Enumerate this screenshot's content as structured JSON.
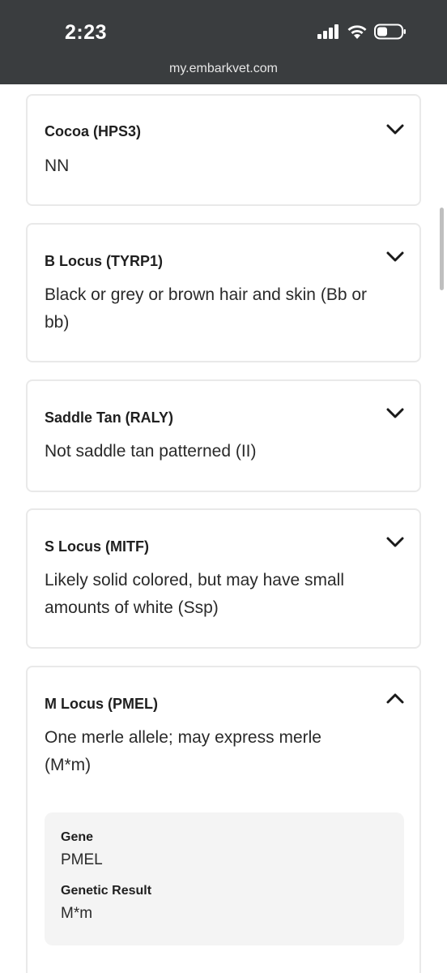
{
  "status_bar": {
    "time": "2:23",
    "url": "my.embarkvet.com",
    "icons": [
      "signal-icon",
      "wifi-icon",
      "battery-icon"
    ]
  },
  "traits": [
    {
      "title": "Cocoa (HPS3)",
      "description": "NN",
      "expanded": false
    },
    {
      "title": "B Locus (TYRP1)",
      "description": "Black or grey or brown hair and skin (Bb or bb)",
      "expanded": false
    },
    {
      "title": "Saddle Tan (RALY)",
      "description": "Not saddle tan patterned (II)",
      "expanded": false
    },
    {
      "title": "S Locus (MITF)",
      "description": "Likely solid colored, but may have small amounts of white (Ssp)",
      "expanded": false
    },
    {
      "title": "M Locus (PMEL)",
      "description": "One merle allele; may express merle (M*m)",
      "expanded": true,
      "details": {
        "gene_label": "Gene",
        "gene_value": "PMEL",
        "result_label": "Genetic Result",
        "result_value": "M*m"
      }
    }
  ]
}
